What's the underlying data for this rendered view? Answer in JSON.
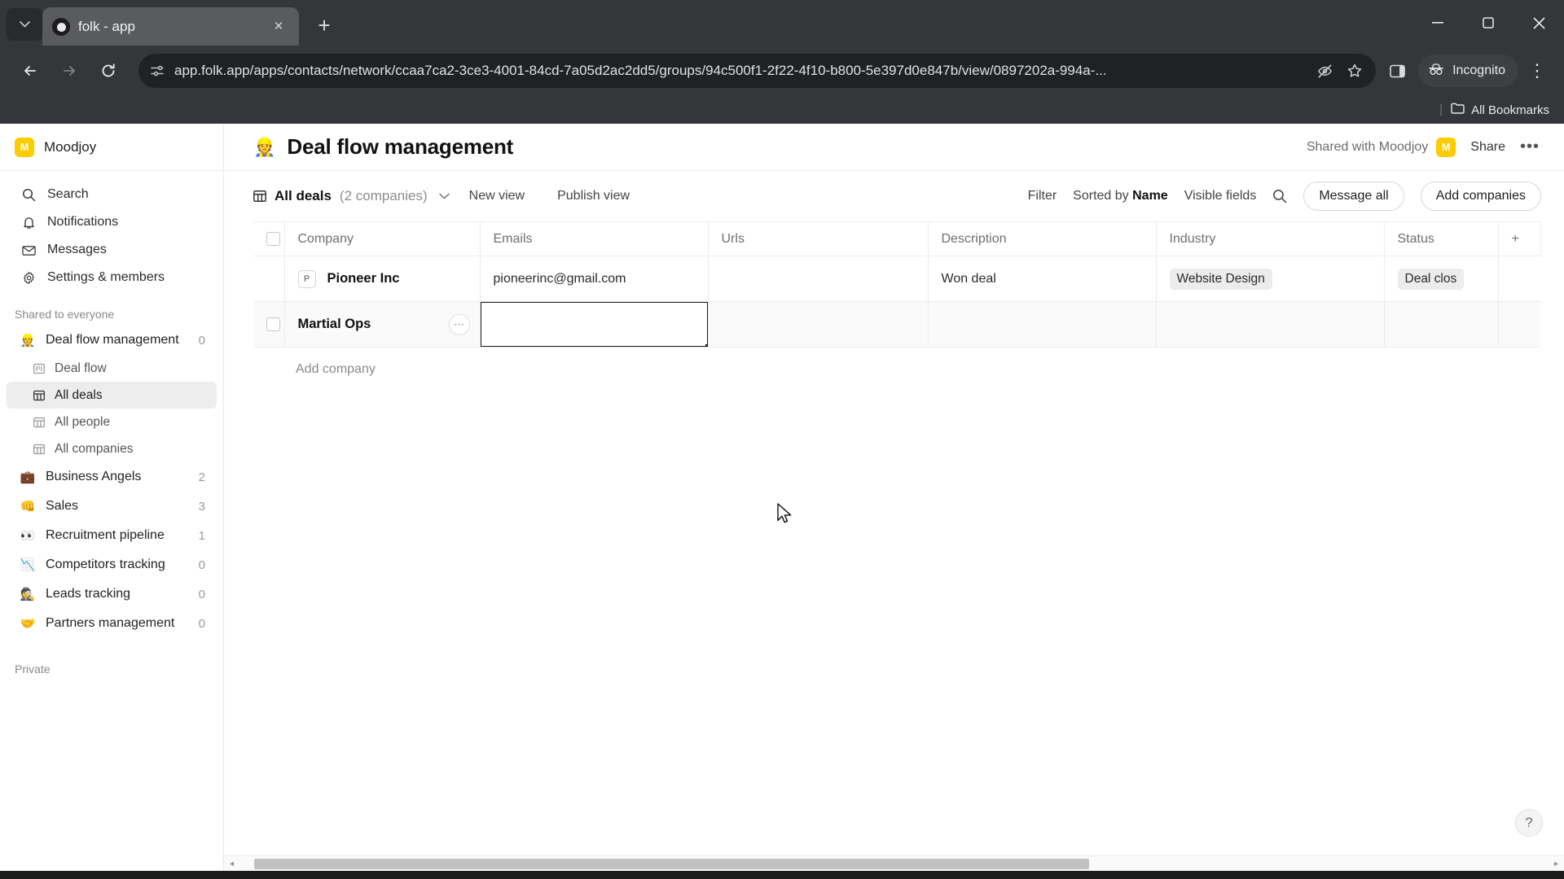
{
  "browser": {
    "tab": {
      "title": "folk - app",
      "favicon": "folk-logo-icon",
      "close": "×"
    },
    "new_tab": "+",
    "window_controls": {
      "minimize": "minimize-icon",
      "maximize": "maximize-icon",
      "close": "close-icon"
    },
    "url": "app.folk.app/apps/contacts/network/ccaa7ca2-3ce3-4001-84cd-7a05d2ac2dd5/groups/94c500f1-2f22-4f10-b800-5e397d0e847b/view/0897202a-994a-...",
    "incognito_label": "Incognito",
    "bookmarks_label": "All Bookmarks",
    "menu_dots": "⋮"
  },
  "sidebar": {
    "workspace": {
      "initial": "M",
      "name": "Moodjoy"
    },
    "nav": [
      {
        "label": "Search",
        "icon": "search-icon"
      },
      {
        "label": "Notifications",
        "icon": "bell-icon"
      },
      {
        "label": "Messages",
        "icon": "envelope-icon"
      },
      {
        "label": "Settings & members",
        "icon": "gear-icon"
      }
    ],
    "shared_label": "Shared to everyone",
    "private_label": "Private",
    "groups": [
      {
        "label": "Deal flow management",
        "emoji": "👷",
        "count": "0",
        "views": [
          {
            "label": "Deal flow",
            "icon": "board-icon",
            "active": false
          },
          {
            "label": "All deals",
            "icon": "table-icon",
            "active": true
          },
          {
            "label": "All people",
            "icon": "table-icon",
            "active": false
          },
          {
            "label": "All companies",
            "icon": "table-icon",
            "active": false
          }
        ]
      },
      {
        "label": "Business Angels",
        "emoji": "💼",
        "count": "2",
        "views": []
      },
      {
        "label": "Sales",
        "emoji": "👊",
        "count": "3",
        "views": []
      },
      {
        "label": "Recruitment pipeline",
        "emoji": "👀",
        "count": "1",
        "views": []
      },
      {
        "label": "Competitors tracking",
        "emoji": "📉",
        "count": "0",
        "views": []
      },
      {
        "label": "Leads tracking",
        "emoji": "🕵️",
        "count": "0",
        "views": []
      },
      {
        "label": "Partners management",
        "emoji": "🤝",
        "count": "0",
        "views": []
      }
    ]
  },
  "header": {
    "emoji": "👷",
    "title": "Deal flow management",
    "shared_with": "Shared with Moodjoy",
    "shared_avatar": "M",
    "share_label": "Share",
    "more_label": "•••"
  },
  "toolbar": {
    "view_icon": "table-icon",
    "view_name": "All deals",
    "view_count": "(2 companies)",
    "new_view": "New view",
    "publish_view": "Publish view",
    "filter": "Filter",
    "sorted_by_prefix": "Sorted by ",
    "sorted_by_value": "Name",
    "visible_fields": "Visible fields",
    "search_icon": "search-icon",
    "message_all": "Message all",
    "add_companies": "Add companies"
  },
  "table": {
    "columns": [
      "Company",
      "Emails",
      "Urls",
      "Description",
      "Industry",
      "Status"
    ],
    "add_column": "+",
    "rows": [
      {
        "avatar": "P",
        "company": "Pioneer Inc",
        "emails": "pioneerinc@gmail.com",
        "urls": "",
        "description": "Won deal",
        "industry": "Website Design",
        "status": "Deal clos",
        "selected_cell": null
      },
      {
        "avatar": "",
        "company": "Martial Ops",
        "emails": "",
        "urls": "",
        "description": "",
        "industry": "",
        "status": "",
        "selected_cell": "emails"
      }
    ],
    "add_company": "Add company"
  },
  "footer": {
    "help": "?",
    "scroll_left_arrow": "◂",
    "scroll_right_arrow": "▸"
  }
}
